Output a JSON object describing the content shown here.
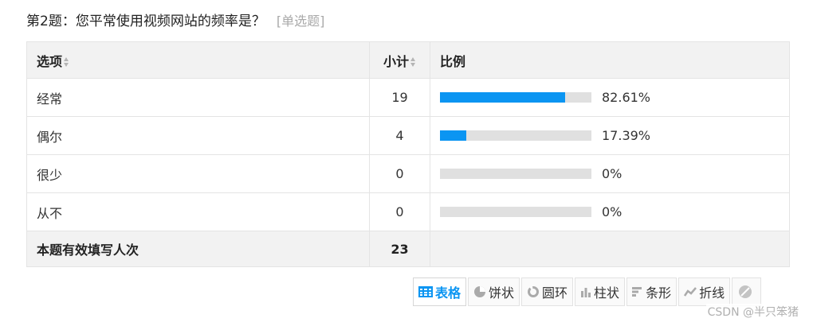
{
  "question": {
    "title": "第2题：您平常使用视频网站的频率是？",
    "type": "[单选题]"
  },
  "table": {
    "headers": {
      "option": "选项",
      "count": "小计",
      "ratio": "比例"
    },
    "rows": [
      {
        "option": "经常",
        "count": "19",
        "percent": "82.61%",
        "fraction": 0.8261
      },
      {
        "option": "偶尔",
        "count": "4",
        "percent": "17.39%",
        "fraction": 0.1739
      },
      {
        "option": "很少",
        "count": "0",
        "percent": "0%",
        "fraction": 0
      },
      {
        "option": "从不",
        "count": "0",
        "percent": "0%",
        "fraction": 0
      }
    ],
    "total": {
      "label": "本题有效填写人次",
      "count": "23"
    }
  },
  "toolbar": {
    "buttons": [
      {
        "label": "表格",
        "icon": "table-icon",
        "active": true
      },
      {
        "label": "饼状",
        "icon": "pie-icon",
        "active": false
      },
      {
        "label": "圆环",
        "icon": "ring-icon",
        "active": false
      },
      {
        "label": "柱状",
        "icon": "column-icon",
        "active": false
      },
      {
        "label": "条形",
        "icon": "bar-icon",
        "active": false
      },
      {
        "label": "折线",
        "icon": "line-icon",
        "active": false
      },
      {
        "label": "",
        "icon": "hide-icon",
        "active": false
      }
    ]
  },
  "watermark": "CSDN @半只笨猪",
  "colors": {
    "accent": "#0b95f2",
    "track": "#e0e0e0",
    "header_bg": "#f2f2f2"
  }
}
